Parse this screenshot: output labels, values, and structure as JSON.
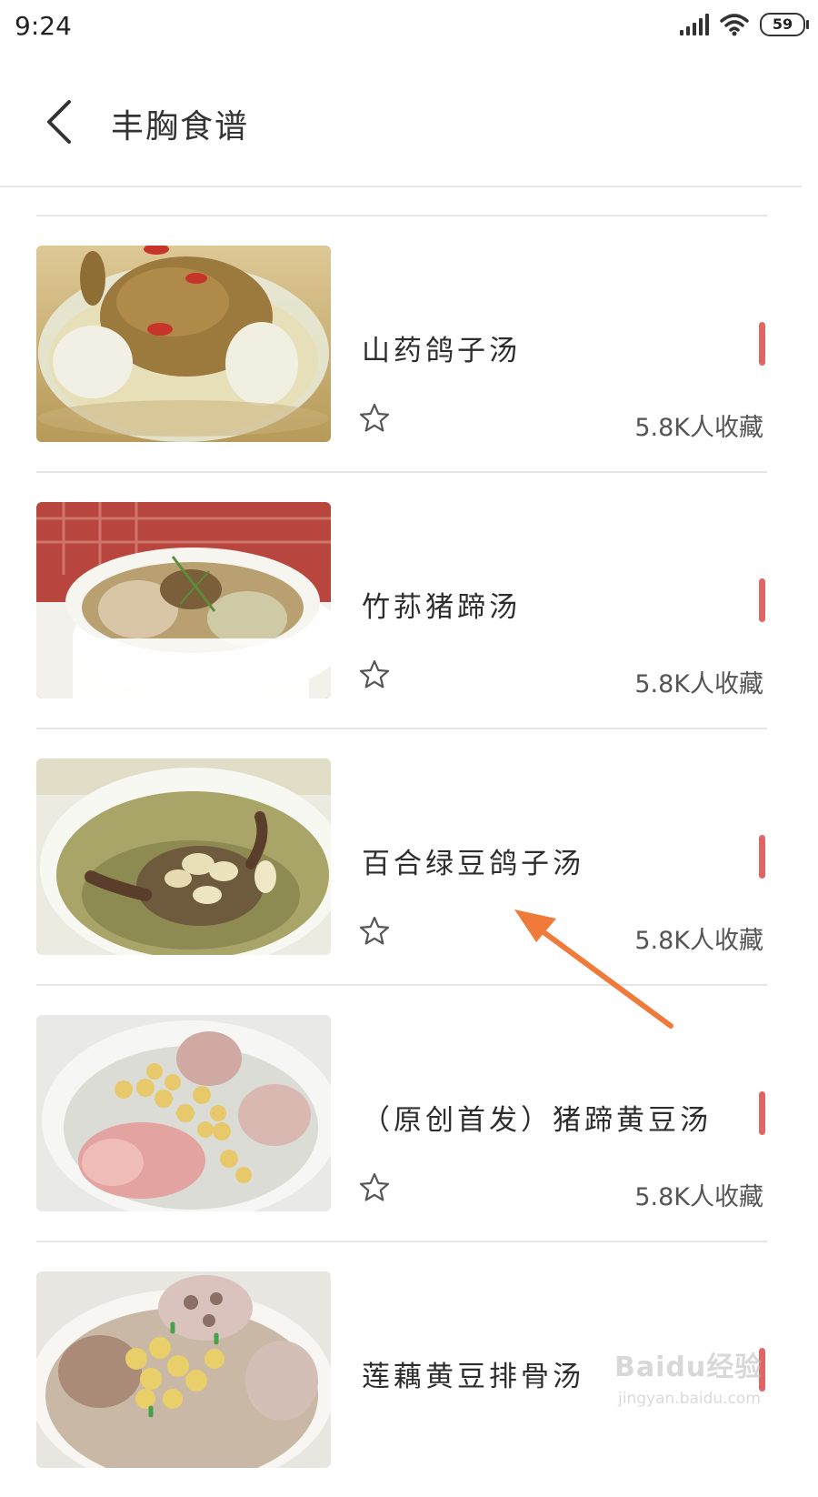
{
  "status_bar": {
    "time": "9:24",
    "battery": "59"
  },
  "header": {
    "title": "丰胸食谱"
  },
  "theme": {
    "accent": "#e06565",
    "divider": "#e5e5e5",
    "annotation_arrow": "#f07a3a"
  },
  "recipes": [
    {
      "name": "山药鸽子汤",
      "favorites": "5.8K人收藏"
    },
    {
      "name": "竹荪猪蹄汤",
      "favorites": "5.8K人收藏"
    },
    {
      "name": "百合绿豆鸽子汤",
      "favorites": "5.8K人收藏"
    },
    {
      "name": "（原创首发）猪蹄黄豆汤",
      "favorites": "5.8K人收藏"
    },
    {
      "name": "莲藕黄豆排骨汤",
      "favorites": ""
    }
  ],
  "watermark": {
    "logo": "Baidu经验",
    "url": "jingyan.baidu.com"
  }
}
